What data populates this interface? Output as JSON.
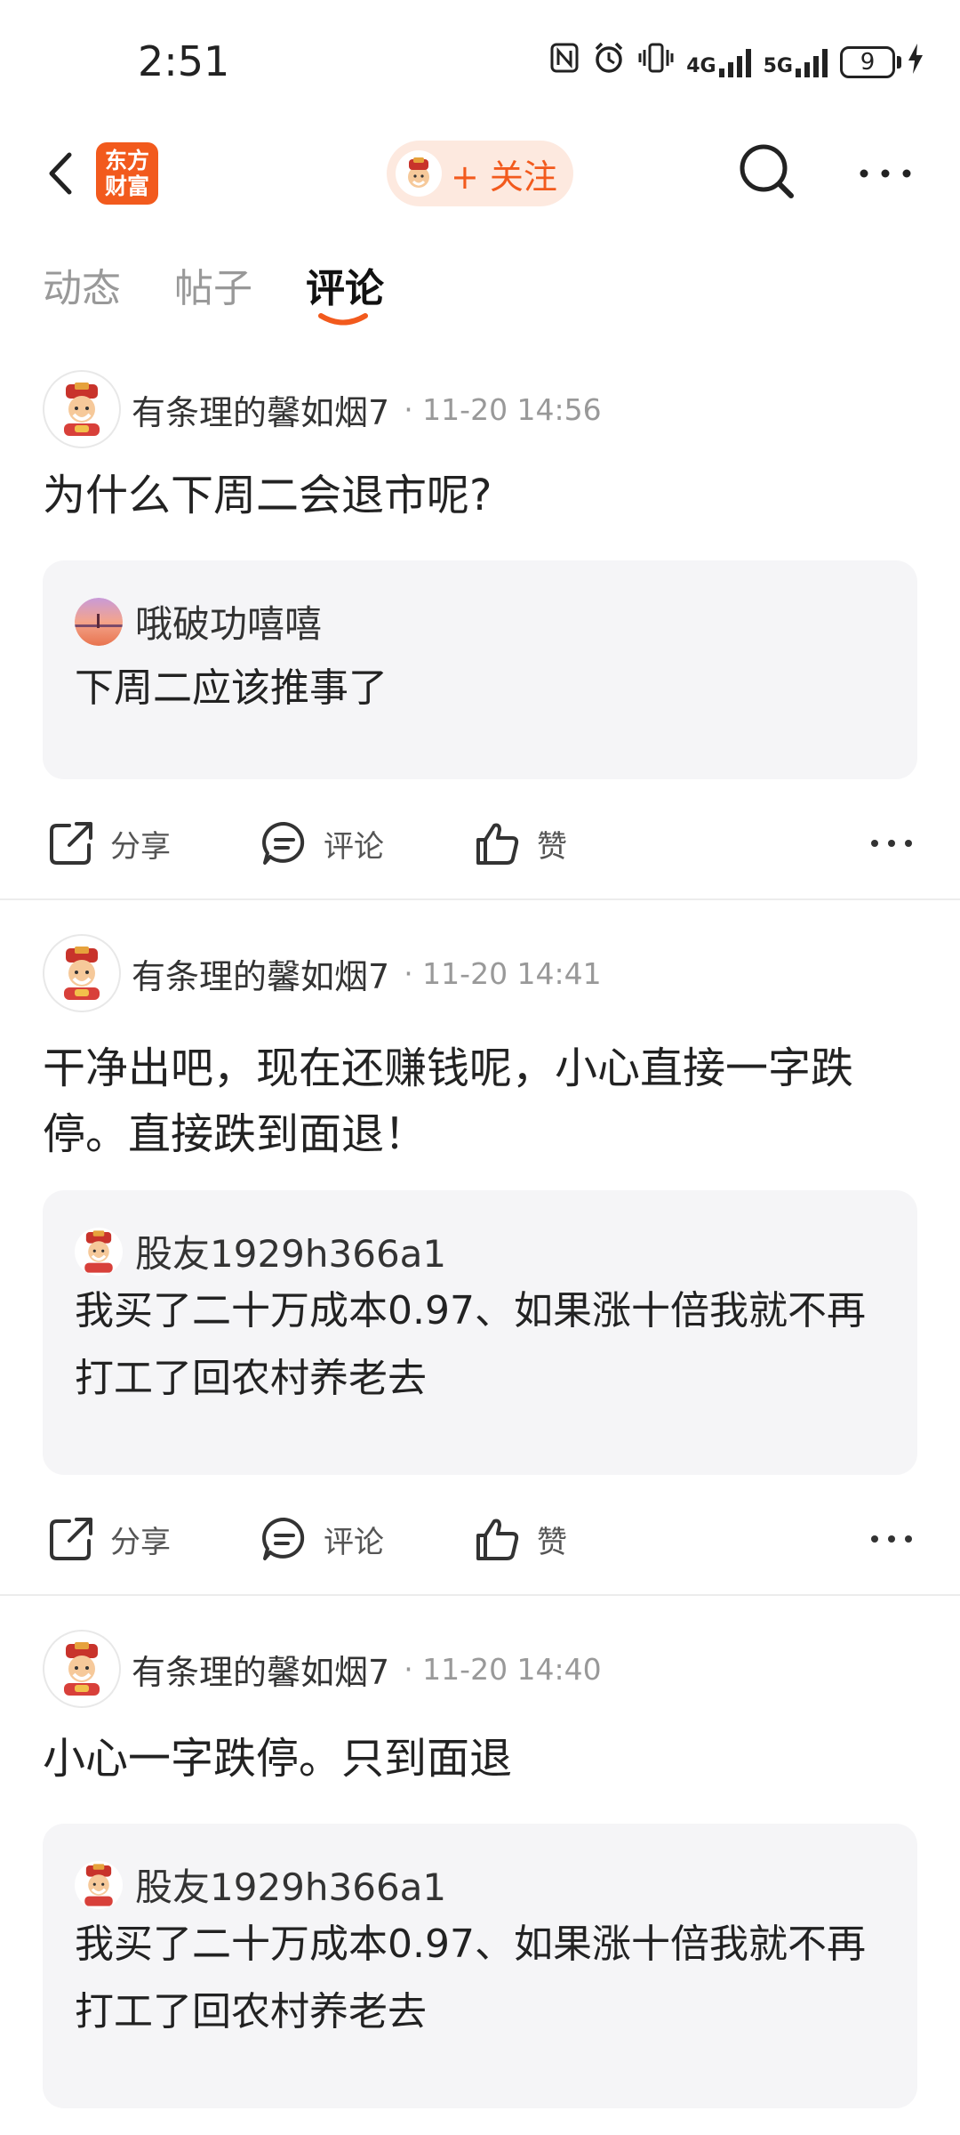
{
  "status_bar": {
    "time": "2:51",
    "battery": "9",
    "network_4g": "4G",
    "network_5g": "5G",
    "icons": [
      "nfc-icon",
      "alarm-icon",
      "vibrate-icon",
      "signal-4g-icon",
      "signal-5g-icon",
      "battery-icon",
      "charging-icon"
    ]
  },
  "header": {
    "logo_line1": "东方",
    "logo_line2": "财富",
    "follow_label": "+ 关注",
    "accent_color": "#f25a1d"
  },
  "tabs": [
    {
      "label": "动态",
      "active": false
    },
    {
      "label": "帖子",
      "active": false
    },
    {
      "label": "评论",
      "active": true
    }
  ],
  "comments": [
    {
      "author": "有条理的馨如烟7",
      "time": "11-20 14:56",
      "text": "为什么下周二会退市呢?",
      "reply": {
        "author": "哦破功嘻嘻",
        "text": "下周二应该推事了"
      },
      "actions": {
        "share": "分享",
        "comment": "评论",
        "like": "赞"
      }
    },
    {
      "author": "有条理的馨如烟7",
      "time": "11-20 14:41",
      "text": "干净出吧，现在还赚钱呢，小心直接一字跌停。直接跌到面退！",
      "reply": {
        "author": "股友1929h366a1",
        "text": "我买了二十万成本0.97、如果涨十倍我就不再打工了回农村养老去"
      },
      "actions": {
        "share": "分享",
        "comment": "评论",
        "like": "赞"
      }
    },
    {
      "author": "有条理的馨如烟7",
      "time": "11-20 14:40",
      "text": "小心一字跌停。只到面退",
      "reply": {
        "author": "股友1929h366a1",
        "text": "我买了二十万成本0.97、如果涨十倍我就不再打工了回农村养老去"
      }
    }
  ]
}
